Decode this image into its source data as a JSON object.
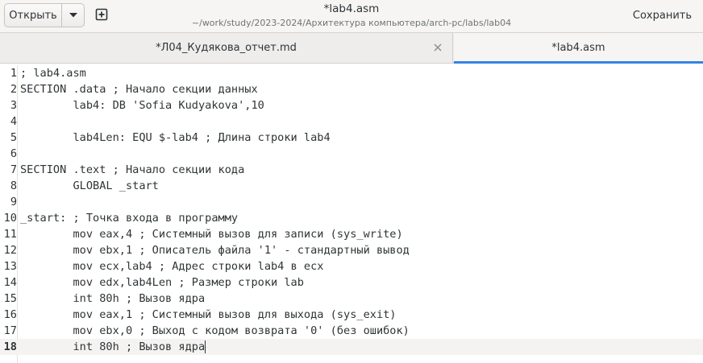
{
  "header": {
    "open_label": "Открыть",
    "title": "*lab4.asm",
    "subtitle": "~/work/study/2023-2024/Архитектура компьютера/arch-pc/labs/lab04",
    "save_label": "Сохранить"
  },
  "tabs": [
    {
      "label": "*Л04_Кудякова_отчет.md",
      "active": false
    },
    {
      "label": "*lab4.asm",
      "active": true
    }
  ],
  "editor": {
    "current_line": 18,
    "lines": [
      {
        "n": "1",
        "text": "; lab4.asm"
      },
      {
        "n": "2",
        "text": "SECTION .data ; Начало секции данных"
      },
      {
        "n": "3",
        "text": "        lab4: DB 'Sofia Kudyakova',10"
      },
      {
        "n": "4",
        "text": ""
      },
      {
        "n": "5",
        "text": "        lab4Len: EQU $-lab4 ; Длина строки lab4"
      },
      {
        "n": "6",
        "text": ""
      },
      {
        "n": "7",
        "text": "SECTION .text ; Начало секции кода"
      },
      {
        "n": "8",
        "text": "        GLOBAL _start"
      },
      {
        "n": "9",
        "text": ""
      },
      {
        "n": "10",
        "text": "_start: ; Точка входа в программу"
      },
      {
        "n": "11",
        "text": "        mov eax,4 ; Системный вызов для записи (sys_write)"
      },
      {
        "n": "12",
        "text": "        mov ebx,1 ; Описатель файла '1' - стандартный вывод"
      },
      {
        "n": "13",
        "text": "        mov ecx,lab4 ; Адрес строки lab4 в ecx"
      },
      {
        "n": "14",
        "text": "        mov edx,lab4Len ; Размер строки lab"
      },
      {
        "n": "15",
        "text": "        int 80h ; Вызов ядра"
      },
      {
        "n": "16",
        "text": "        mov eax,1 ; Системный вызов для выхода (sys_exit)"
      },
      {
        "n": "17",
        "text": "        mov ebx,0 ; Выход с кодом возврата '0' (без ошибок)"
      },
      {
        "n": "18",
        "text": "        int 80h ; Вызов ядра"
      }
    ]
  },
  "colors": {
    "accent": "#3584e4",
    "headerbar_bg": "#f6f5f4",
    "current_line_bg": "#f4f3f2"
  }
}
